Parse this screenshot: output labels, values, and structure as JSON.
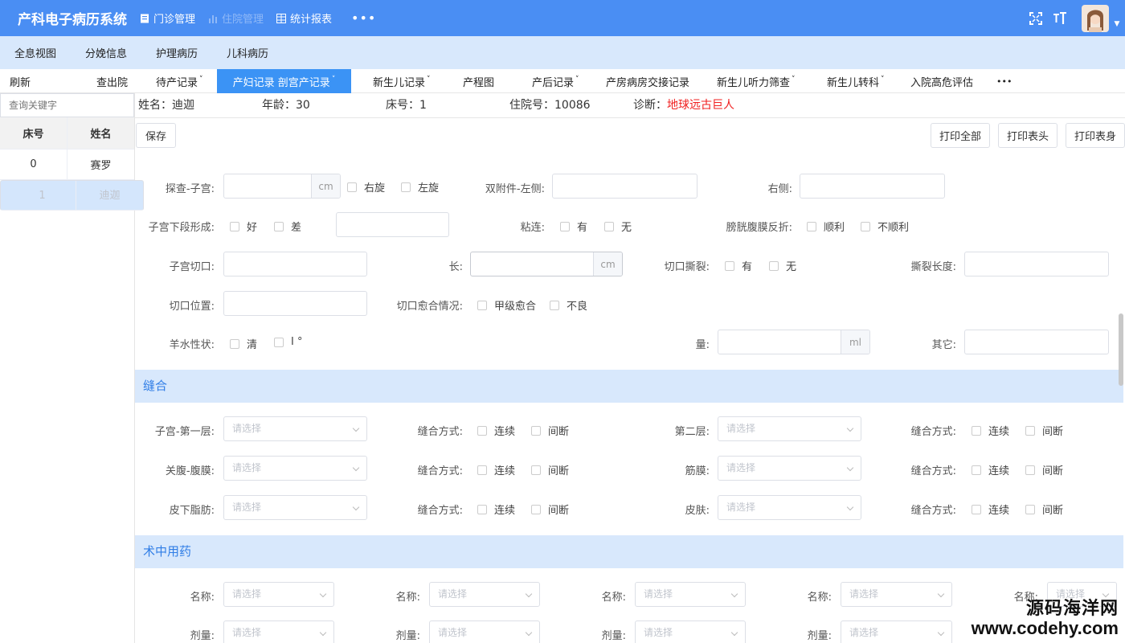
{
  "app": {
    "title": "产科电子病历系统"
  },
  "topnav": [
    {
      "label": "门诊管理",
      "icon": "document-icon"
    },
    {
      "label": "住院管理",
      "icon": "bar-chart-icon"
    },
    {
      "label": "统计报表",
      "icon": "grid-icon"
    }
  ],
  "topnav_more": "•••",
  "subnav": [
    "全息视图",
    "分娩信息",
    "护理病历",
    "儿科病历"
  ],
  "recnav": {
    "refresh": "刷新",
    "discharge": "查出院",
    "items": [
      "待产记录",
      "产妇记录 剖宫产记录",
      "新生儿记录",
      "产程图",
      "产后记录",
      "产房病房交接记录",
      "新生儿听力筛查",
      "新生儿转科",
      "入院高危评估"
    ],
    "more": "•••"
  },
  "sidebar": {
    "search_placeholder": "查询关键字",
    "columns": [
      "床号",
      "姓名"
    ],
    "rows": [
      {
        "bed": "0",
        "name": "赛罗"
      },
      {
        "bed": "1",
        "name": "迪迦"
      }
    ]
  },
  "patient": {
    "name": "姓名：迪迦",
    "age": "年龄：30",
    "bed": "床号：1",
    "admission": "住院号：10086",
    "diagnosis_label": "诊断：",
    "diagnosis": "地球远古巨人"
  },
  "toolbar": {
    "save": "保存",
    "print_all": "打印全部",
    "print_header": "打印表头",
    "print_body": "打印表身"
  },
  "exam": {
    "uterus_label": "探查-子宫:",
    "unit_cm": "cm",
    "rotate_right": "右旋",
    "rotate_left": "左旋",
    "adnexa_left": "双附件-左侧:",
    "right": "右侧:",
    "lower_segment": "子宫下段形成:",
    "good": "好",
    "poor": "差",
    "adhesion": "粘连:",
    "yes": "有",
    "no": "无",
    "bladder": "膀胱腹膜反折:",
    "smooth": "顺利",
    "not_smooth": "不顺利",
    "incision": "子宫切口:",
    "length": "长:",
    "tear": "切口撕裂:",
    "tear_length": "撕裂长度:",
    "incision_position": "切口位置:",
    "healing": "切口愈合情况:",
    "healing_a": "甲级愈合",
    "healing_bad": "不良",
    "amniotic": "羊水性状:",
    "clear": "清",
    "degree1": "I °",
    "amount": "量:",
    "unit_ml": "ml",
    "other": "其它:"
  },
  "suture": {
    "title": "缝合",
    "placeholder": "请选择",
    "method": "缝合方式:",
    "continuous": "连续",
    "interrupted": "间断",
    "rows": [
      {
        "left": "子宫-第一层:",
        "right": "第二层:"
      },
      {
        "left": "关腹-腹膜:",
        "right": "筋膜:"
      },
      {
        "left": "皮下脂肪:",
        "right": "皮肤:"
      }
    ]
  },
  "meds": {
    "title": "术中用药",
    "name": "名称:",
    "dose": "剂量:",
    "placeholder": "请选择"
  },
  "watermark": {
    "line1": "源码海洋网",
    "line2": "www.codehy.com"
  }
}
